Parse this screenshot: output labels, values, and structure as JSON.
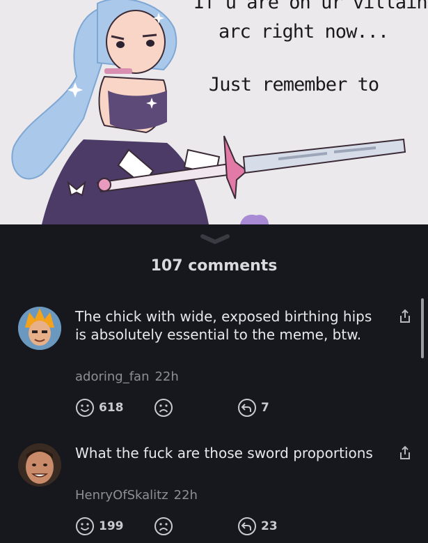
{
  "meme": {
    "caption_line1": "If u are on ur villain",
    "caption_line2": "arc right now...",
    "caption_line3": "Just remember to"
  },
  "comments_header": {
    "count_label": "107 comments"
  },
  "comments": [
    {
      "text": "The chick with wide, exposed birthing hips is absolutely essential to the meme, btw.",
      "author": "adoring_fan",
      "time": "22h",
      "upvotes": "618",
      "replies": "7"
    },
    {
      "text": "What the fuck are those sword proportions",
      "author": "HenryOfSkalitz",
      "time": "22h",
      "upvotes": "199",
      "replies": "23"
    }
  ],
  "icons": {
    "upvote": "smile-icon",
    "downvote": "frown-icon",
    "reply": "reply-icon",
    "share": "share-icon"
  },
  "colors": {
    "background": "#17181d",
    "text": "#e8e8ec",
    "meta": "#8e8f96"
  }
}
